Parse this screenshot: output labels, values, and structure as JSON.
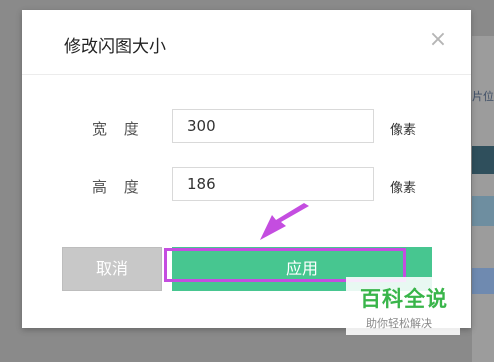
{
  "dialog": {
    "title": "修改闪图大小",
    "close_glyph": "×",
    "width_label": "宽 度",
    "width_value": "300",
    "height_label": "高 度",
    "height_value": "186",
    "unit": "像素",
    "cancel_label": "取消",
    "apply_label": "应用"
  },
  "background": {
    "fragment_text": "片位"
  },
  "watermark": {
    "title": "百科全说",
    "subtitle": "助你轻松解决"
  },
  "colors": {
    "apply_green": "#47c690",
    "cancel_gray": "#c8c8c8",
    "highlight_purple": "#c44de0",
    "watermark_green": "#39b54a"
  }
}
